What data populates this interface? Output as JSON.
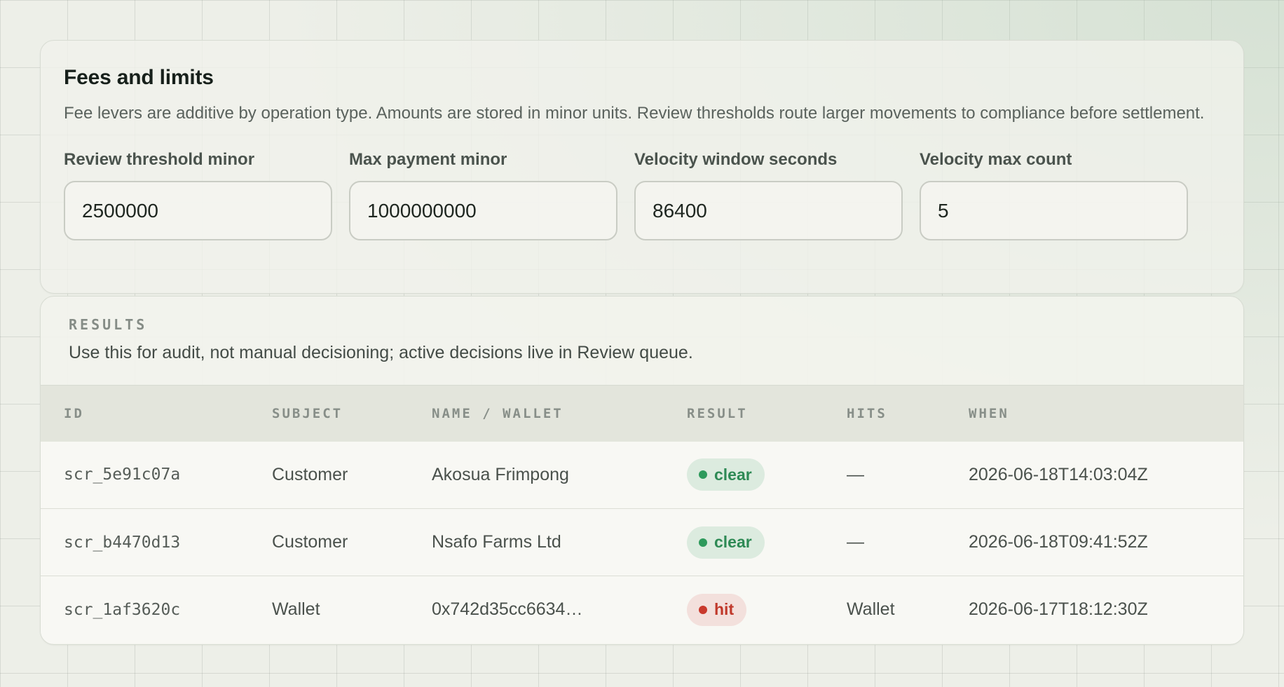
{
  "fees": {
    "title": "Fees and limits",
    "description": "Fee levers are additive by operation type. Amounts are stored in minor units. Review thresholds route larger movements to compliance before settlement.",
    "fields": [
      {
        "label": "Review threshold minor",
        "value": "2500000"
      },
      {
        "label": "Max payment minor",
        "value": "1000000000"
      },
      {
        "label": "Velocity window seconds",
        "value": "86400"
      },
      {
        "label": "Velocity max count",
        "value": "5"
      }
    ]
  },
  "results": {
    "eyebrow": "RESULTS",
    "note": "Use this for audit, not manual decisioning; active decisions live in Review queue.",
    "columns": [
      "ID",
      "SUBJECT",
      "NAME / WALLET",
      "RESULT",
      "HITS",
      "WHEN"
    ],
    "rows": [
      {
        "id": "scr_5e91c07a",
        "subject": "Customer",
        "name": "Akosua Frimpong",
        "result": "clear",
        "hits": "—",
        "when": "2026-06-18T14:03:04Z"
      },
      {
        "id": "scr_b4470d13",
        "subject": "Customer",
        "name": "Nsafo Farms Ltd",
        "result": "clear",
        "hits": "—",
        "when": "2026-06-18T09:41:52Z"
      },
      {
        "id": "scr_1af3620c",
        "subject": "Wallet",
        "name": "0x742d35cc6634…",
        "result": "hit",
        "hits": "Wallet",
        "when": "2026-06-17T18:12:30Z"
      }
    ]
  },
  "colors": {
    "clear": "#2e8a55",
    "hit": "#c0392b",
    "background": "#edefe8"
  }
}
